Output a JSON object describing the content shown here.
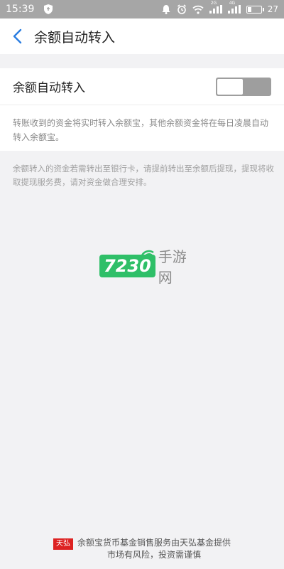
{
  "status_bar": {
    "time": "15:39",
    "signal1_label": "2G",
    "signal2_label": "4G",
    "battery_level": "27",
    "left_icons": [
      "shield-icon"
    ],
    "right_icons": [
      "alarm-bell-icon",
      "alarm-clock-icon",
      "wifi-icon",
      "signal-icon",
      "signal-icon",
      "battery-icon"
    ]
  },
  "header": {
    "title": "余额自动转入"
  },
  "setting": {
    "label": "余额自动转入",
    "enabled": false
  },
  "description": "转账收到的资金将实时转入余额宝，其他余额资金将在每日凌晨自动转入余额宝。",
  "notice": "余额转入的资金若需转出至银行卡，请提前转出至余额后提现，提现将收取提现服务费，请对资金做合理安排。",
  "watermark": {
    "number": "7230",
    "text": "手游网"
  },
  "footer": {
    "logo": "天弘",
    "line1": "余额宝货币基金销售服务由天弘基金提供",
    "line2": "市场有风险，投资需谨慎"
  },
  "colors": {
    "accent": "#2a7de1",
    "status_bar": "#a6a6a6",
    "toggle_off": "#9e9e9e",
    "watermark_green": "#2fbf68",
    "footer_logo": "#dd2222"
  }
}
